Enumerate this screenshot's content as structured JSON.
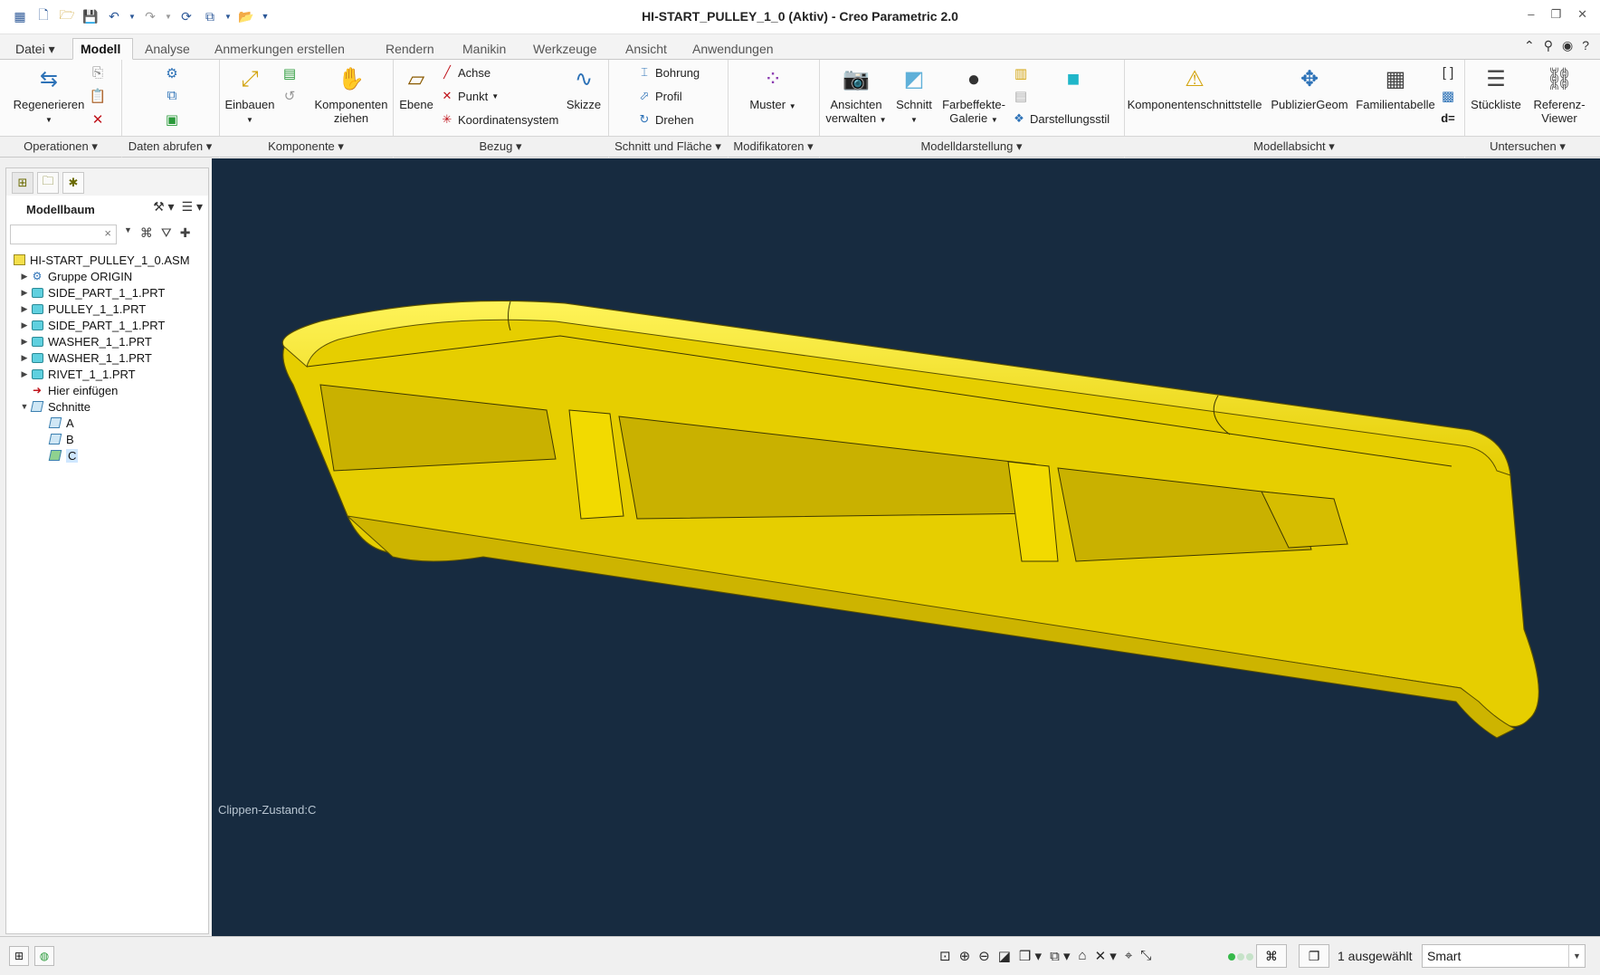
{
  "window": {
    "title": "HI-START_PULLEY_1_0 (Aktiv) - Creo Parametric 2.0"
  },
  "tabs": [
    "Datei",
    "Modell",
    "Analyse",
    "Anmerkungen erstellen",
    "Rendern",
    "Manikin",
    "Werkzeuge",
    "Ansicht",
    "Anwendungen"
  ],
  "ribbon": {
    "regenerate": "Regenerieren",
    "einbauen": "Einbauen",
    "komponenten_ziehen_1": "Komponenten",
    "komponenten_ziehen_2": "ziehen",
    "ebene": "Ebene",
    "achse": "Achse",
    "punkt": "Punkt",
    "koordinatensystem": "Koordinatensystem",
    "skizze": "Skizze",
    "bohrung": "Bohrung",
    "profil": "Profil",
    "drehen": "Drehen",
    "muster": "Muster",
    "ansichten_1": "Ansichten",
    "ansichten_2": "verwalten",
    "schnitt": "Schnitt",
    "farbeffekte_1": "Farbeffekte-",
    "farbeffekte_2": "Galerie",
    "darstellungsstil": "Darstellungsstil",
    "komponentenschnittstelle": "Komponentenschnittstelle",
    "publiziergeom": "PublizierGeom",
    "familientabelle": "Familientabelle",
    "stueckliste": "Stückliste",
    "referenz_1": "Referenz-",
    "referenz_2": "Viewer",
    "d_eq": "d="
  },
  "groups": [
    "Operationen",
    "Daten abrufen",
    "Komponente",
    "Bezug",
    "Schnitt und Fläche",
    "Modifikatoren",
    "Modelldarstellung",
    "Modellabsicht",
    "Untersuchen"
  ],
  "tree": {
    "header": "Modellbaum",
    "search_clear": "×",
    "items": [
      {
        "label": "HI-START_PULLEY_1_0.ASM"
      },
      {
        "label": "Gruppe ORIGIN"
      },
      {
        "label": "SIDE_PART_1_1.PRT"
      },
      {
        "label": "PULLEY_1_1.PRT"
      },
      {
        "label": "SIDE_PART_1_1.PRT"
      },
      {
        "label": "WASHER_1_1.PRT"
      },
      {
        "label": "WASHER_1_1.PRT"
      },
      {
        "label": "RIVET_1_1.PRT"
      },
      {
        "label": "Hier einfügen"
      },
      {
        "label": "Schnitte"
      },
      {
        "label": "A"
      },
      {
        "label": "B"
      },
      {
        "label": "C"
      }
    ]
  },
  "viewport": {
    "clip_state": "Clippen-Zustand:C",
    "background": "#172b40",
    "model_color": "#f2df00"
  },
  "status": {
    "selected": "1 ausgewählt",
    "filter": "Smart"
  }
}
